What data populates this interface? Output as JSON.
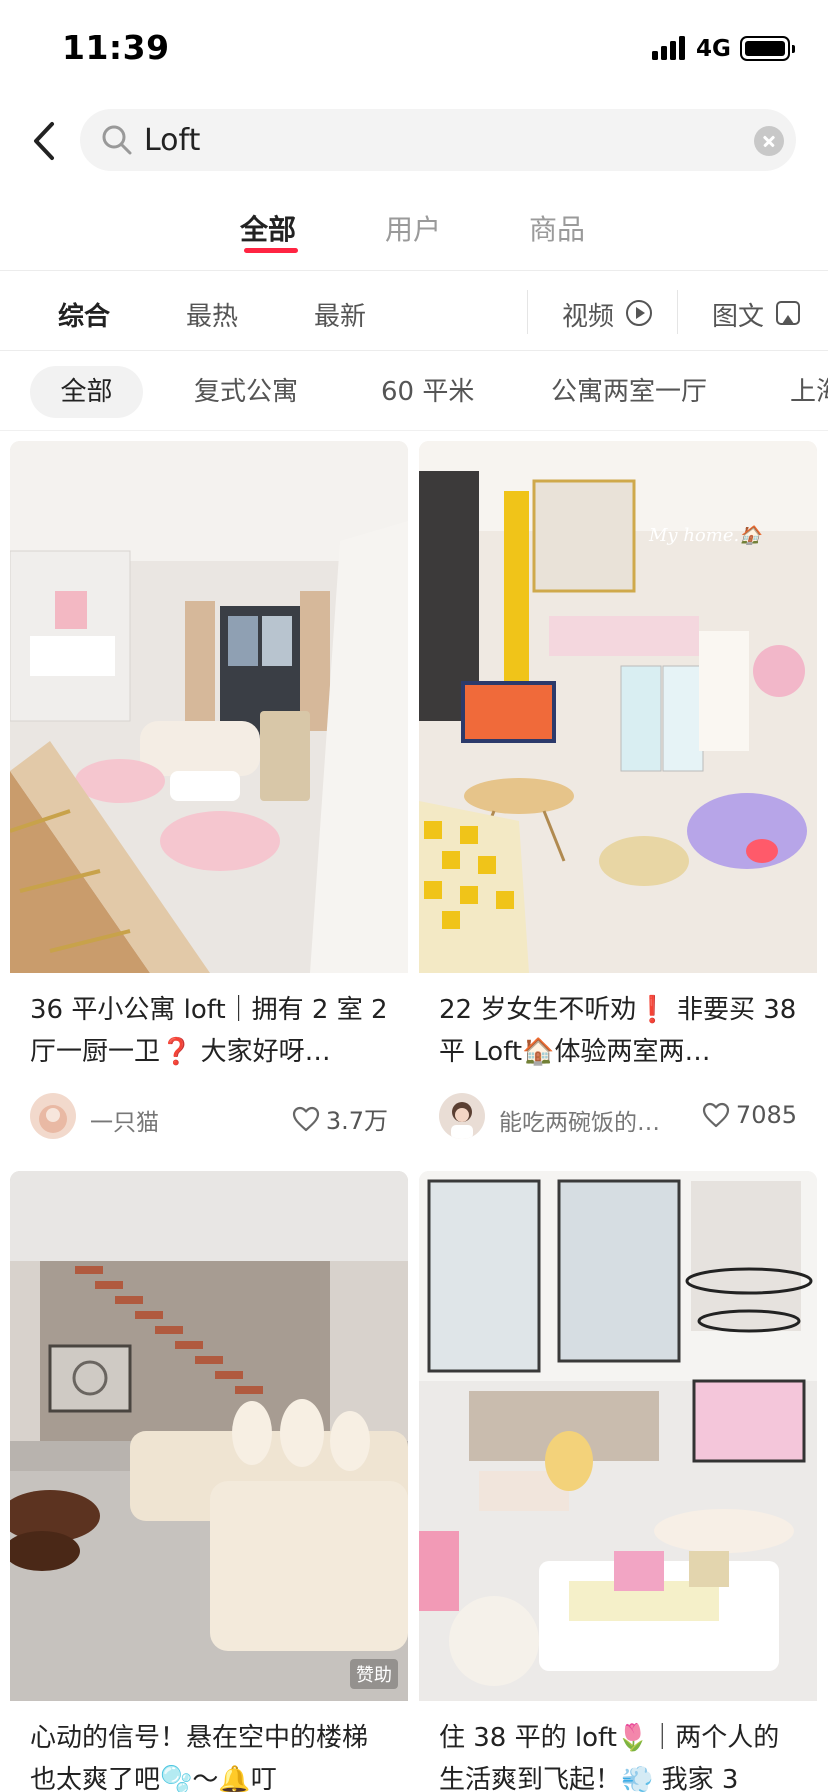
{
  "status_bar": {
    "time": "11:39",
    "network": "4G",
    "icons": [
      "signal-icon",
      "battery-icon"
    ]
  },
  "search": {
    "back_icon": "chevron-left-icon",
    "search_icon": "search-icon",
    "query": "Loft",
    "clear_icon": "clear-icon"
  },
  "main_tabs": [
    {
      "label": "全部",
      "active": true
    },
    {
      "label": "用户",
      "active": false
    },
    {
      "label": "商品",
      "active": false
    }
  ],
  "sort_tabs": [
    {
      "label": "综合",
      "active": true
    },
    {
      "label": "最热",
      "active": false
    },
    {
      "label": "最新",
      "active": false
    }
  ],
  "media_filters": [
    {
      "label": "视频",
      "icon": "play-circle-icon"
    },
    {
      "label": "图文",
      "icon": "image-icon"
    }
  ],
  "chips": [
    {
      "label": "全部",
      "active": true
    },
    {
      "label": "复式公寓",
      "active": false
    },
    {
      "label": "60 平米",
      "active": false
    },
    {
      "label": "公寓两室一厅",
      "active": false
    },
    {
      "label": "上海",
      "active": false
    }
  ],
  "cards": [
    {
      "title": "36 平小公寓 loft｜拥有 2 室 2 厅一厨一卫❓ 大家好呀…",
      "author": "一只猫",
      "likes": "3.7万",
      "photo_caption": ""
    },
    {
      "title": "22 岁女生不听劝❗ 非要买 38 平 Loft🏠体验两室两…",
      "author": "能吃两碗饭的…",
      "likes": "7085",
      "photo_caption": "My home.🏠"
    },
    {
      "title": "心动的信号！悬在空中的楼梯也太爽了吧🫧～🔔叮",
      "author": "",
      "likes": "",
      "sponsor": "赞助"
    },
    {
      "title": "住 38 平的 loft🌷｜两个人的生活爽到飞起！💨 我家 3",
      "author": "",
      "likes": ""
    }
  ],
  "colors": {
    "accent": "#ff2442",
    "chip_bg": "#f2f2f2",
    "search_bg": "#f3f3f3"
  }
}
